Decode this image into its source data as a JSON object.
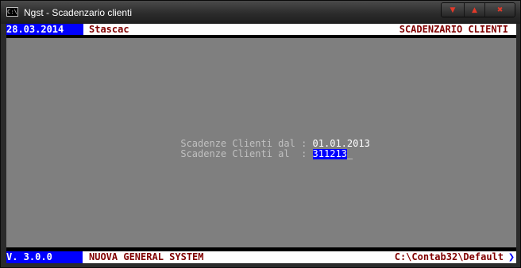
{
  "window": {
    "title": "Ngst - Scadenzario clienti",
    "icon": "console-icon",
    "icon_text": "C:\\",
    "buttons": {
      "minimize": "▼",
      "maximize": "▲",
      "close": "✖"
    }
  },
  "header": {
    "date": "28.03.2014",
    "program": "Stascac",
    "screen_title": "SCADENZARIO CLIENTI"
  },
  "form": {
    "from_label": "Scadenze Clienti dal :",
    "from_value": "01.01.2013",
    "to_label": "Scadenze Clienti al  :",
    "to_value": "311213",
    "cursor": "_"
  },
  "footer": {
    "version": "V. 3.0.0",
    "system_name": "NUOVA GENERAL SYSTEM",
    "path": "C:\\Contab32\\Default",
    "scroll_icon": "chevron-down-icon",
    "scroll_glyph": "❯"
  },
  "colors": {
    "console_background": "#7f7f7f",
    "status_bar_background": "#ffffff",
    "highlight_blue": "#0000ff",
    "status_text_maroon": "#800000",
    "label_text": "#c0c0c0",
    "value_text": "#ffffff",
    "caption_button_red": "#e23a2a"
  }
}
